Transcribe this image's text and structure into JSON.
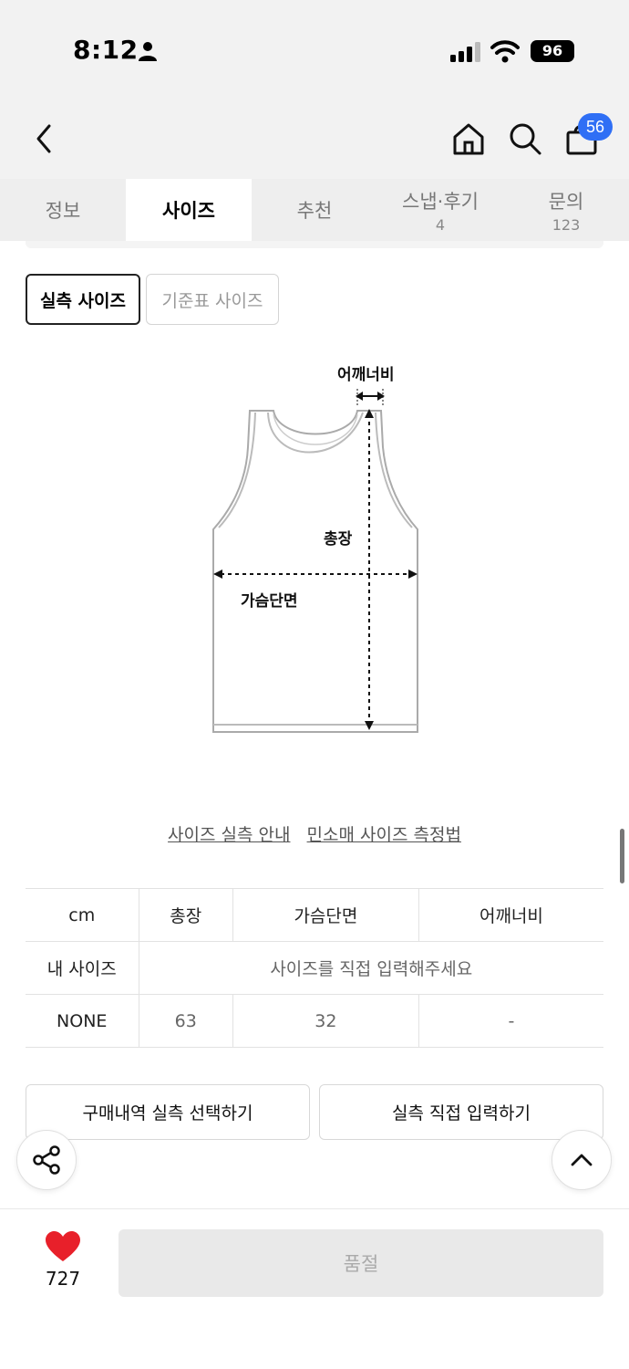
{
  "status": {
    "time": "8:12",
    "battery": "96"
  },
  "nav": {
    "cart_count": "56"
  },
  "tabs": [
    {
      "label": "정보",
      "sub": ""
    },
    {
      "label": "사이즈",
      "sub": ""
    },
    {
      "label": "추천",
      "sub": ""
    },
    {
      "label": "스냅·후기",
      "sub": "4"
    },
    {
      "label": "문의",
      "sub": "123"
    }
  ],
  "size_toggle": {
    "actual": "실측 사이즈",
    "standard": "기준표 사이즈"
  },
  "diagram": {
    "shoulder": "어깨너비",
    "length": "총장",
    "chest": "가슴단면"
  },
  "links": {
    "guide": "사이즈 실측 안내",
    "method": "민소매 사이즈 측정법"
  },
  "table": {
    "headers": [
      "cm",
      "총장",
      "가슴단면",
      "어깨너비"
    ],
    "my_size_label": "내 사이즈",
    "my_size_placeholder": "사이즈를 직접 입력해주세요",
    "rows": [
      {
        "name": "NONE",
        "values": [
          "63",
          "32",
          "-"
        ]
      }
    ]
  },
  "actions": {
    "select_purchase": "구매내역 실측 선택하기",
    "manual_input": "실측 직접 입력하기"
  },
  "bottom": {
    "likes": "727",
    "soldout": "품절"
  },
  "colors": {
    "accent_blue": "#2f6ff5",
    "heart_red": "#e8202a",
    "header_bg": "#f2f2f2"
  }
}
